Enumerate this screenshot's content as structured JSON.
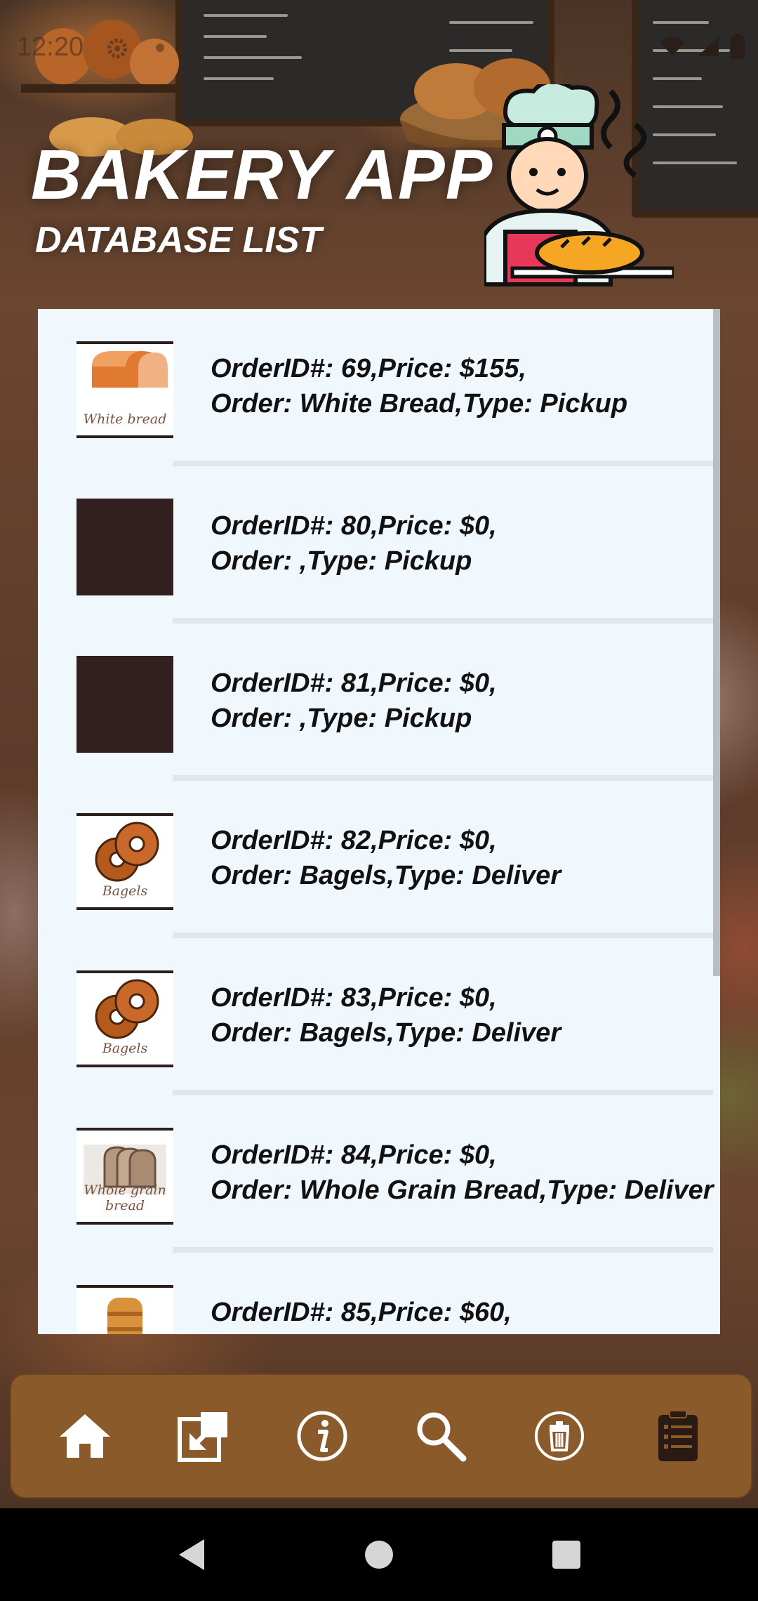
{
  "status_bar": {
    "time": "12:20",
    "icons": [
      "settings-icon",
      "dot-icon",
      "wifi-icon",
      "signal-icon",
      "battery-icon"
    ]
  },
  "header": {
    "title": "BAKERY APP",
    "subtitle": "DATABASE LIST",
    "logo": "chef-with-bread-icon"
  },
  "orders": [
    {
      "line1": "OrderID#: 69,Price: $155,",
      "line2": "Order: White Bread,Type: Pickup",
      "image": "white-bread-icon",
      "caption": "White bread"
    },
    {
      "line1": "OrderID#: 80,Price: $0,",
      "line2": "Order: ,Type: Pickup",
      "image": "empty",
      "caption": ""
    },
    {
      "line1": "OrderID#: 81,Price: $0,",
      "line2": "Order: ,Type: Pickup",
      "image": "empty",
      "caption": ""
    },
    {
      "line1": "OrderID#: 82,Price: $0,",
      "line2": "Order: Bagels,Type: Deliver",
      "image": "bagels-icon",
      "caption": "Bagels"
    },
    {
      "line1": "OrderID#: 83,Price: $0,",
      "line2": "Order: Bagels,Type: Deliver",
      "image": "bagels-icon",
      "caption": "Bagels"
    },
    {
      "line1": "OrderID#: 84,Price: $0,",
      "line2": "Order: Whole Grain Bread,Type: Deliver",
      "image": "whole-grain-bread-icon",
      "caption": "Whole grain bread"
    },
    {
      "line1": "OrderID#: 85,Price: $60,",
      "line2": "",
      "image": "bread-loaf-icon",
      "caption": ""
    }
  ],
  "bottom_nav": [
    "home-icon",
    "open-external-icon",
    "info-icon",
    "search-icon",
    "delete-icon",
    "list-icon"
  ],
  "system_nav": [
    "back-icon",
    "home-circle-icon",
    "recents-icon"
  ],
  "colors": {
    "panel": "#f1f8fd",
    "nav_bar": "#8b5a2b",
    "text": "#111111",
    "thumb_empty": "#31201f"
  }
}
